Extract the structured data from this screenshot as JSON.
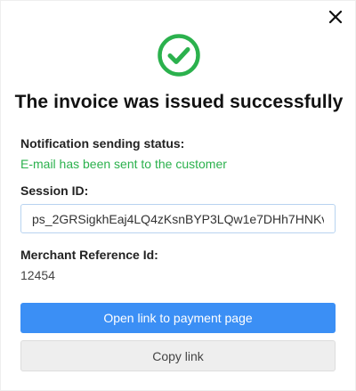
{
  "dialog": {
    "close_icon": "close-icon",
    "success_icon": "check-circle-icon",
    "title": "The invoice was issued successfully"
  },
  "notification": {
    "label": "Notification sending status:",
    "status": "E-mail has been sent to the customer"
  },
  "session": {
    "label": "Session ID:",
    "value": "ps_2GRSigkhEaj4LQ4zKsnBYP3LQw1e7DHh7HNKv..."
  },
  "merchant_reference": {
    "label": "Merchant Reference Id:",
    "value": "12454"
  },
  "actions": {
    "open_link_label": "Open link to payment page",
    "copy_link_label": "Copy link"
  },
  "colors": {
    "success": "#2bb14d",
    "primary": "#3b8ff5",
    "secondary_bg": "#eeeeee"
  }
}
